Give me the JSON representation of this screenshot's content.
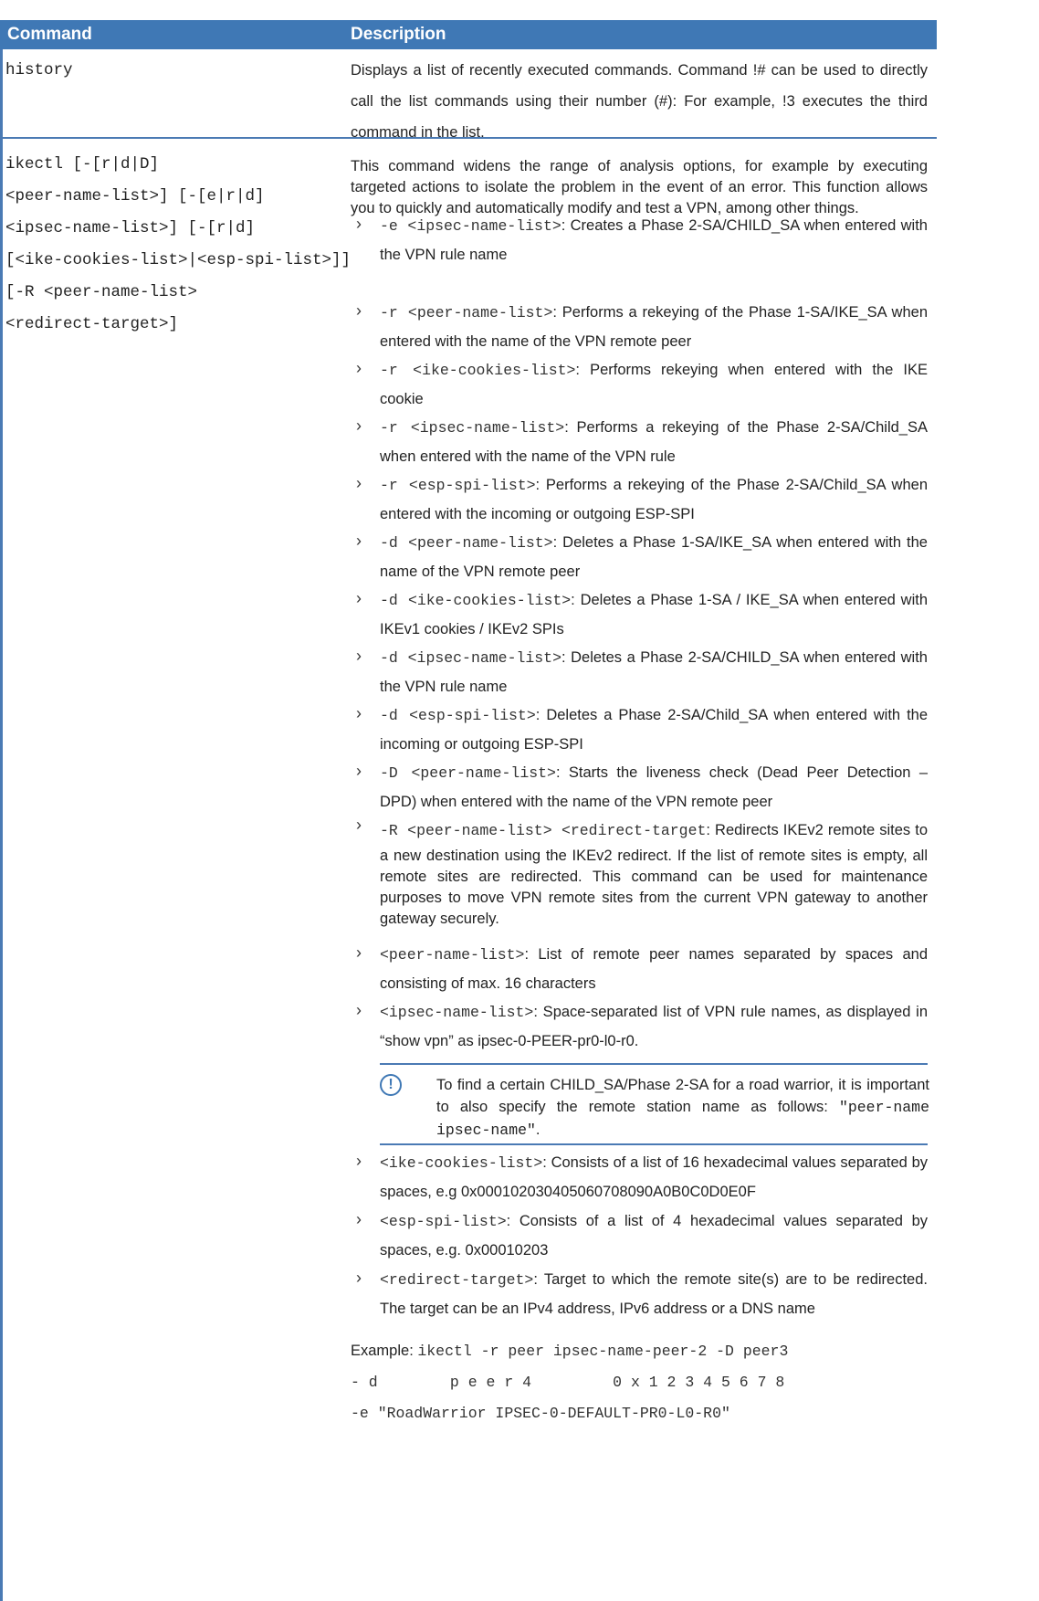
{
  "header": {
    "command": "Command",
    "description": "Description"
  },
  "rows": [
    {
      "command_lines": [
        "history"
      ],
      "description": "Displays a list of recently executed commands. Command !# can be used to directly call the list commands using their number (#): For example, !3 executes the third command in the list."
    },
    {
      "command_lines": [
        "ikectl [-[r|d|D]",
        "<peer-name-list>] [-[e|r|d]",
        "<ipsec-name-list>] [-[r|d]",
        "[<ike-cookies-list>|<esp-spi-list>]]",
        "[-R <peer-name-list>",
        "<redirect-target>]"
      ],
      "intro": "This command widens the range of analysis options, for example by executing targeted actions to isolate the problem in the event of an error. This function allows you to quickly and automatically modify and test a VPN, among other things.",
      "bullets": [
        {
          "code": "-e <ipsec-name-list>",
          "text": ": Creates a Phase 2-SA/CHILD_SA when entered with the VPN rule name"
        },
        {
          "code": "-r <peer-name-list>",
          "text": ": Performs a rekeying of the Phase 1-SA/IKE_SA when entered with the name of the VPN remote peer"
        },
        {
          "code": "-r <ike-cookies-list>",
          "text": ": Performs rekeying when entered with the IKE cookie"
        },
        {
          "code": "-r <ipsec-name-list>",
          "text": ": Performs a rekeying of the Phase 2-SA/Child_SA when entered with the name of the VPN rule"
        },
        {
          "code": "-r <esp-spi-list>",
          "text": ": Performs a rekeying of the Phase 2-SA/Child_SA when entered with the incoming or outgoing ESP-SPI"
        },
        {
          "code": "-d <peer-name-list>",
          "text": ": Deletes a Phase 1-SA/IKE_SA when entered with the name of the VPN remote peer"
        },
        {
          "code": "-d <ike-cookies-list>",
          "text": ": Deletes a Phase 1-SA / IKE_SA when entered with IKEv1 cookies / IKEv2 SPIs"
        },
        {
          "code": "-d <ipsec-name-list>",
          "text": ": Deletes a Phase 2-SA/CHILD_SA when entered with the VPN rule name"
        },
        {
          "code": "-d <esp-spi-list>",
          "text": ": Deletes a Phase 2-SA/Child_SA when entered with the incoming or outgoing ESP-SPI"
        },
        {
          "code": "-D <peer-name-list>",
          "text": ": Starts the liveness check (Dead Peer Detection – DPD) when entered with the name of the VPN remote peer"
        },
        {
          "code": "-R <peer-name-list> <redirect-target",
          "text": ": Redirects IKEv2 remote sites to a new destination using the IKEv2 redirect. If the list of remote sites is empty, all remote sites are redirected. This command can be used for maintenance purposes to move VPN remote sites from the current VPN gateway to another gateway securely."
        },
        {
          "code": "<peer-name-list>",
          "text": ": List of remote peer names separated by spaces and consisting of max. 16 characters"
        },
        {
          "code": "<ipsec-name-list>",
          "text": ": Space-separated list of VPN rule names, as displayed in “show vpn” as ipsec-0-PEER-pr0-l0-r0."
        }
      ],
      "note": {
        "text": "To find a certain CHILD_SA/Phase 2-SA for a road warrior, it is important to also specify the remote station name as follows:",
        "code": "\"peer-name ipsec-name\"",
        "end": "."
      },
      "bullets2": [
        {
          "code": "<ike-cookies-list>",
          "text": ": Consists of a list of 16 hexadecimal values separated by spaces, e.g 0x000102030405060708090A0B0C0D0E0F"
        },
        {
          "code": "<esp-spi-list>",
          "text": ": Consists of a list of 4 hexadecimal values separated by spaces, e.g. 0x00010203"
        },
        {
          "code": "<redirect-target>",
          "text": ": Target to which the remote site(s) are to be redirected. The target can be an IPv4 address, IPv6 address or a DNS name"
        }
      ],
      "example": {
        "label": "Example: ",
        "line1": "ikectl -r peer ipsec-name-peer-2 -D peer3",
        "line2": "- d        p e e r 4         0 x 1 2 3 4 5 6 7 8",
        "line3": "-e \"RoadWarrior IPSEC-0-DEFAULT-PR0-L0-R0\""
      }
    }
  ]
}
